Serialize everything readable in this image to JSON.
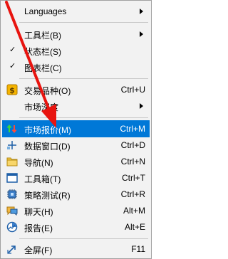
{
  "menu": {
    "items": [
      {
        "label": "Languages",
        "shortcut": ""
      },
      {
        "label": "工具栏(B)",
        "shortcut": ""
      },
      {
        "label": "状态栏(S)",
        "shortcut": ""
      },
      {
        "label": "图表栏(C)",
        "shortcut": ""
      },
      {
        "label": "交易品种(O)",
        "shortcut": "Ctrl+U"
      },
      {
        "label": "市场深度",
        "shortcut": ""
      },
      {
        "label": "市场报价(M)",
        "shortcut": "Ctrl+M"
      },
      {
        "label": "数据窗口(D)",
        "shortcut": "Ctrl+D"
      },
      {
        "label": "导航(N)",
        "shortcut": "Ctrl+N"
      },
      {
        "label": "工具箱(T)",
        "shortcut": "Ctrl+T"
      },
      {
        "label": "策略测试(R)",
        "shortcut": "Ctrl+R"
      },
      {
        "label": "聊天(H)",
        "shortcut": "Alt+M"
      },
      {
        "label": "报告(E)",
        "shortcut": "Alt+E"
      },
      {
        "label": "全屏(F)",
        "shortcut": "F11"
      }
    ]
  },
  "colors": {
    "highlight": "#0078d7",
    "arrow": "#e8140f"
  }
}
